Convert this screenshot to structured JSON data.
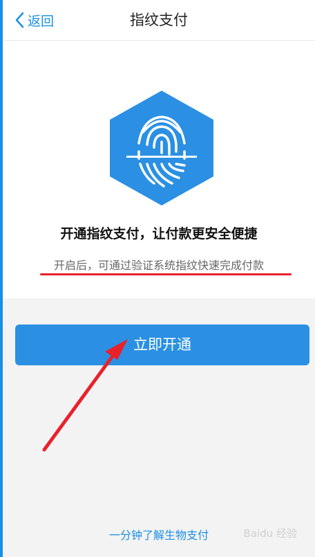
{
  "header": {
    "back_label": "返回",
    "title": "指纹支付"
  },
  "intro": {
    "headline": "开通指纹支付，让付款更安全便捷",
    "description": "开启后，可通过验证系统指纹快速完成付款"
  },
  "actions": {
    "enable_label": "立即开通",
    "learn_more_label": "一分钟了解生物支付"
  },
  "watermark": "Baidu 经验",
  "icons": {
    "back": "chevron-left-icon",
    "logo": "fingerprint-icon",
    "annotation": "red-arrow"
  },
  "colors": {
    "brand_blue": "#2b90e3",
    "link_blue": "#1a8fe3",
    "annotation_red": "#e8212b",
    "section_gray": "#f3f3f3"
  }
}
